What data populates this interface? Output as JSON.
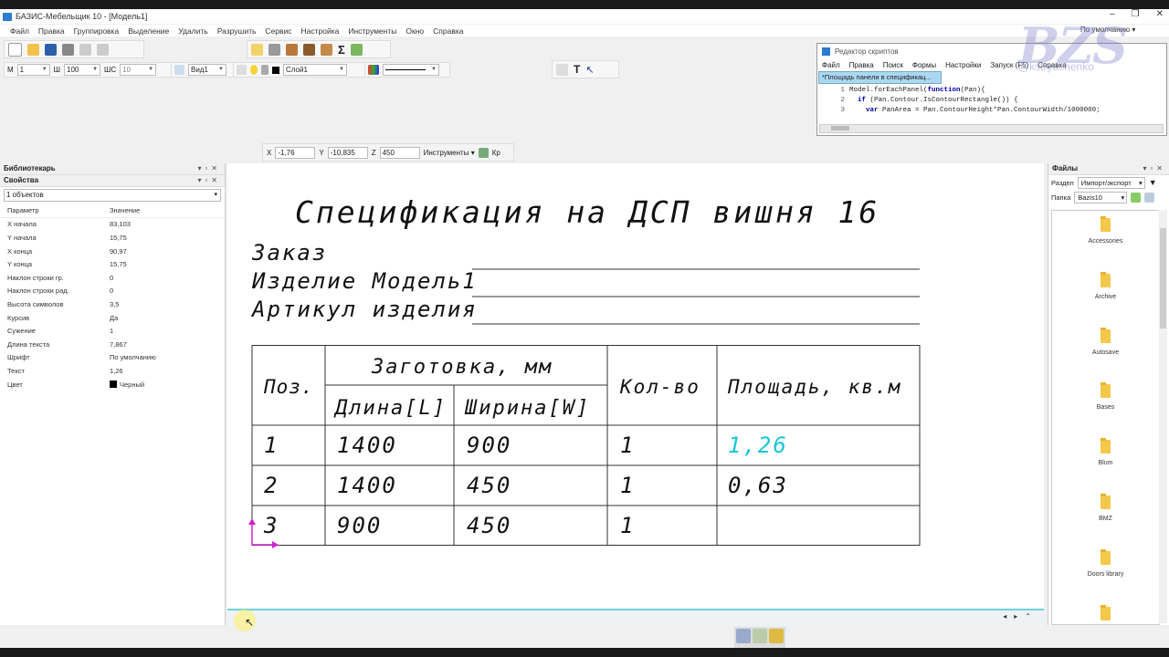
{
  "window": {
    "title": "БАЗИС-Мебельщик 10 - [Модель1]",
    "controls": [
      "–",
      "❐",
      "✕"
    ]
  },
  "menu": [
    "Файл",
    "Правка",
    "Группировка",
    "Выделение",
    "Удалить",
    "Разрушить",
    "Сервис",
    "Настройка",
    "Инструменты",
    "Окно",
    "Справка"
  ],
  "toolbar2": {
    "m_label": "М",
    "m_value": "1",
    "sh_label": "Ш",
    "sh_value": "100",
    "shs_label": "ШС",
    "shs_value": "10",
    "view_value": "Вид1",
    "layer_value": "Слой1"
  },
  "coords": {
    "x_label": "X",
    "x_value": "-1,76",
    "y_label": "Y",
    "y_value": "-10,835",
    "z_label": "Z",
    "z_value": "450",
    "tools_label": "Инструменты",
    "kr_label": "Кр"
  },
  "view_menu": "По умолчанию",
  "left_panel": {
    "librarian_title": "Библиотекарь",
    "props_title": "Свойства",
    "selection": "1 объектов",
    "col_param": "Параметр",
    "col_value": "Значение",
    "rows": [
      {
        "k": "X начала",
        "v": "83,103"
      },
      {
        "k": "Y начала",
        "v": "15,75"
      },
      {
        "k": "X конца",
        "v": "90,97"
      },
      {
        "k": "Y конца",
        "v": "15,75"
      },
      {
        "k": "Наклон строки гр.",
        "v": "0"
      },
      {
        "k": "Наклон строки рад.",
        "v": "0"
      },
      {
        "k": "Высота символов",
        "v": "3,5"
      },
      {
        "k": "Курсив",
        "v": "Да"
      },
      {
        "k": "Сужение",
        "v": "1"
      },
      {
        "k": "Длина текста",
        "v": "7,867"
      },
      {
        "k": "Шрифт",
        "v": "По умолчанию"
      },
      {
        "k": "Текст",
        "v": "1,26"
      }
    ],
    "color_key": "Цвет",
    "color_value": "Черный"
  },
  "script_editor": {
    "title": "Редактор скриптов",
    "menu": [
      "Файл",
      "Правка",
      "Поиск",
      "Формы",
      "Настройки",
      "Запуск (F5)",
      "Справка"
    ],
    "tab": "*Площадь панели в спецификац...",
    "lines": [
      {
        "n": "1",
        "pre": "Model.forEachPanel(",
        "kw": "function",
        "post": "(Pan){"
      },
      {
        "n": "2",
        "pre": "  ",
        "kw": "if",
        "post": " (Pan.Contour.IsContourRectangle()) {"
      },
      {
        "n": "3",
        "pre": "    ",
        "kw": "var",
        "post": " PanArea = Pan.ContourHeight*Pan.ContourWidth/1000000;"
      }
    ]
  },
  "watermark": {
    "logo": "BZS",
    "handle": "@kstryuchenko"
  },
  "spec": {
    "title": "Спецификация на ДСП вишня 16",
    "line_order": "Заказ",
    "line_product": "Изделие Модель1",
    "line_article": "Артикул изделия",
    "h_pos": "Поз.",
    "h_blank": "Заготовка, мм",
    "h_len": "Длина[L]",
    "h_wid": "Ширина[W]",
    "h_qty": "Кол-во",
    "h_area": "Площадь, кв.м",
    "rows": [
      {
        "pos": "1",
        "len": "1400",
        "wid": "900",
        "qty": "1",
        "area": "1,26"
      },
      {
        "pos": "2",
        "len": "1400",
        "wid": "450",
        "qty": "1",
        "area": "0,63"
      },
      {
        "pos": "3",
        "len": "900",
        "wid": "450",
        "qty": "1",
        "area": ""
      }
    ],
    "highlight_color": "#19c6d6"
  },
  "files_panel": {
    "title": "Файлы",
    "section_label": "Раздел",
    "section_value": "Импорт/экспорт",
    "folder_label": "Папка",
    "folder_value": "Bazis10",
    "folders": [
      "Accessories",
      "Archive",
      "Autosave",
      "Bases",
      "Blum",
      "BMZ",
      "Doors library",
      ""
    ]
  }
}
